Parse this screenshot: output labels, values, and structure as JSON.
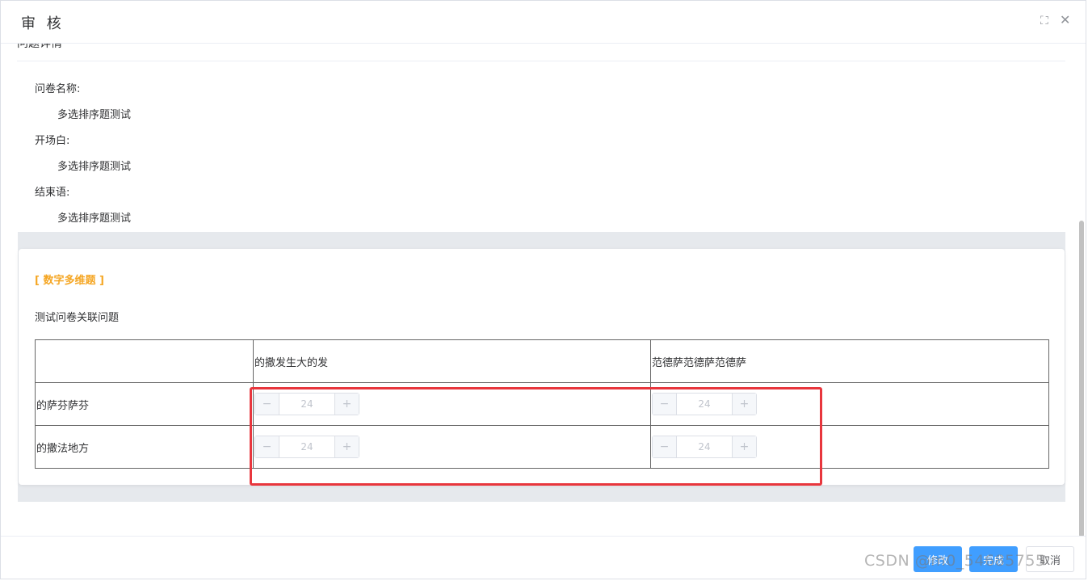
{
  "dialog": {
    "title": "审 核",
    "fullscreen_icon": "expand-icon",
    "close_icon": "close-icon"
  },
  "details": {
    "section_title": "问题详情",
    "items": [
      {
        "label": "问卷名称:",
        "value": "多选排序题测试"
      },
      {
        "label": "开场白:",
        "value": "多选排序题测试"
      },
      {
        "label": "结束语:",
        "value": "多选排序题测试"
      }
    ]
  },
  "question": {
    "type_label": "[ 数字多维题 ]",
    "text": "测试问卷关联问题",
    "columns": [
      "",
      "的撒发生大的发",
      "范德萨范德萨范德萨"
    ],
    "rows": [
      {
        "label": "的萨芬萨芬",
        "values": [
          "24",
          "24"
        ]
      },
      {
        "label": "的撒法地方",
        "values": [
          "24",
          "24"
        ]
      }
    ]
  },
  "footer": {
    "buttons": [
      "修改",
      "完成",
      "取消"
    ]
  },
  "watermark": "CSDN @m0_54685755",
  "colors": {
    "accent": "#409eff",
    "type_label": "#f5a623",
    "highlight": "#e8363d"
  }
}
